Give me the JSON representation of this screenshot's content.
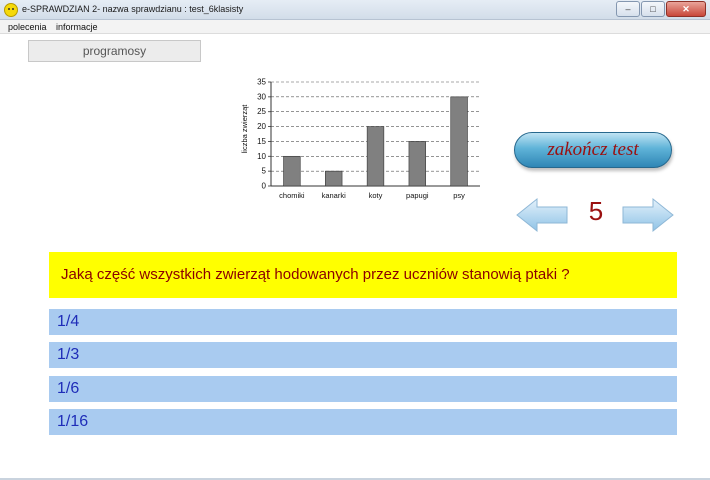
{
  "window": {
    "title": "e-SPRAWDZIAN 2- nazwa sprawdzianu : test_6klasisty",
    "minimize_glyph": "–",
    "maximize_glyph": "□",
    "close_glyph": "✕"
  },
  "menu": {
    "items": [
      "polecenia",
      "informacje"
    ]
  },
  "program_button": "programosy",
  "chart_data": {
    "type": "bar",
    "categories": [
      "chomiki",
      "kanarki",
      "koty",
      "papugi",
      "psy"
    ],
    "values": [
      10,
      5,
      20,
      15,
      30
    ],
    "ylabel": "liczba  zwierząt",
    "xlabel": "",
    "ylim": [
      0,
      35
    ],
    "yticks": [
      0,
      5,
      10,
      15,
      20,
      25,
      30,
      35
    ],
    "grid": "horizontal-dashed",
    "bar_color": "#808080",
    "legend": "none"
  },
  "finish_button": "zakończ  test",
  "navigation": {
    "question_number": "5"
  },
  "question_text": "Jaką część wszystkich zwierząt hodowanych przez uczniów stanowią ptaki ?",
  "answers": [
    "1/4",
    "1/3",
    "1/6",
    "1/16"
  ],
  "colors": {
    "question_bg": "#ffff00",
    "question_text": "#8b0000",
    "answer_bg": "#a9cbf0",
    "answer_text": "#1f2db8",
    "accent_red": "#9a1010"
  }
}
